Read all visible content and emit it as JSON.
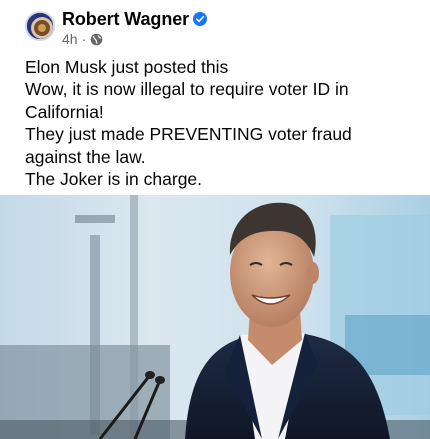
{
  "post": {
    "author": "Robert Wagner",
    "time": "4h",
    "separator": "·",
    "lines": [
      "Elon Musk just posted this",
      "Wow, it is now illegal to require voter ID in",
      "California!",
      "They just made PREVENTING voter fraud",
      "against the law.",
      "The Joker is in charge."
    ],
    "icons": [
      "verified-badge-icon",
      "globe-icon"
    ],
    "colors": {
      "verified": "#1877f2",
      "meta": "#65676b",
      "text": "#050505"
    }
  }
}
